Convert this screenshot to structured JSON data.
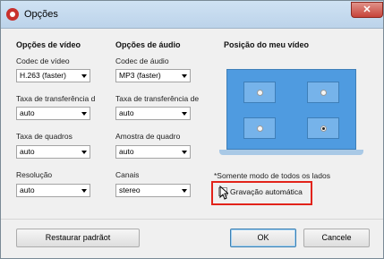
{
  "window": {
    "title": "Opções",
    "close_label": "✕"
  },
  "video": {
    "heading": "Opções de vídeo",
    "codec_label": "Codec de vídeo",
    "codec_value": "H.263 (faster)",
    "bitrate_label": "Taxa de transferência d",
    "bitrate_value": "auto",
    "framerate_label": "Taxa de quadros",
    "framerate_value": "auto",
    "resolution_label": "Resolução",
    "resolution_value": "auto"
  },
  "audio": {
    "heading": "Opções de áudio",
    "codec_label": "Codec de áudio",
    "codec_value": "MP3 (faster)",
    "bitrate_label": "Taxa de transferência de",
    "bitrate_value": "auto",
    "samplerate_label": "Amostra de quadro",
    "samplerate_value": "auto",
    "channels_label": "Canais",
    "channels_value": "stereo"
  },
  "position": {
    "heading": "Posição do meu vídeo",
    "selected": "bottom-right",
    "note": "*Somente modo de todos os lados",
    "auto_record_label": "Gravação automática",
    "auto_record_checked": false
  },
  "buttons": {
    "restore": "Restaurar padrãot",
    "ok": "OK",
    "cancel": "Cancele"
  },
  "colors": {
    "preview_bg": "#4f9be0",
    "highlight": "#e2231a"
  }
}
